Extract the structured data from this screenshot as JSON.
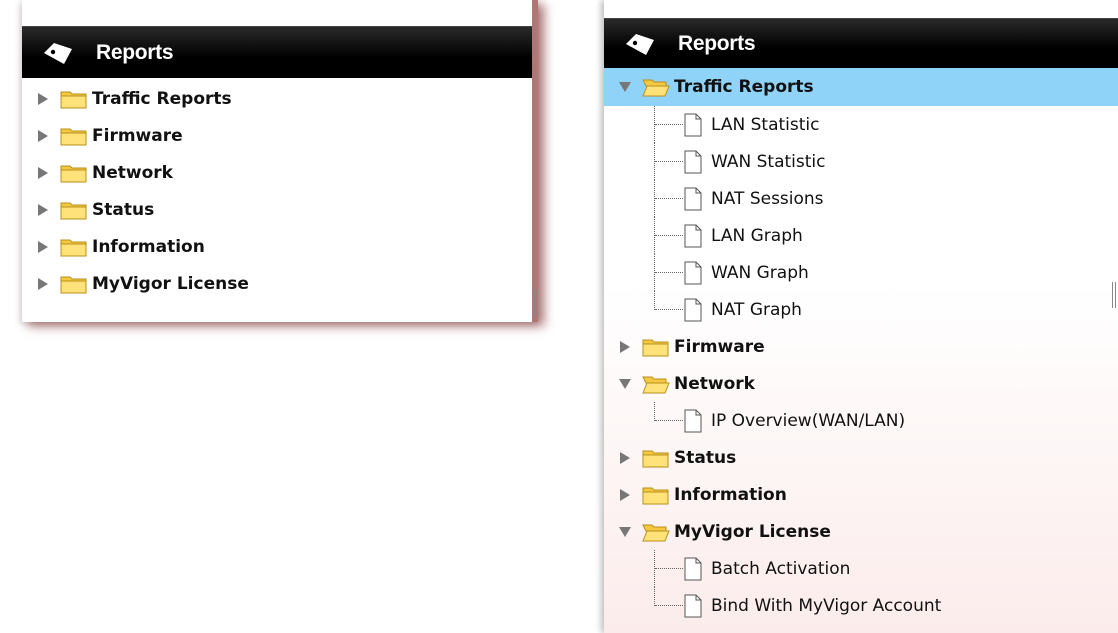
{
  "left_panel": {
    "title": "Reports",
    "items": [
      {
        "label": "Traffic Reports"
      },
      {
        "label": "Firmware"
      },
      {
        "label": "Network"
      },
      {
        "label": "Status"
      },
      {
        "label": "Information"
      },
      {
        "label": "MyVigor License"
      }
    ]
  },
  "right_panel": {
    "title": "Reports",
    "items": [
      {
        "label": "Traffic Reports",
        "expanded": true,
        "selected": true,
        "children": [
          "LAN Statistic",
          "WAN Statistic",
          "NAT Sessions",
          "LAN Graph",
          "WAN Graph",
          "NAT Graph"
        ]
      },
      {
        "label": "Firmware",
        "expanded": false
      },
      {
        "label": "Network",
        "expanded": true,
        "children": [
          "IP Overview(WAN/LAN)"
        ]
      },
      {
        "label": "Status",
        "expanded": false
      },
      {
        "label": "Information",
        "expanded": false
      },
      {
        "label": "MyVigor License",
        "expanded": true,
        "children": [
          "Batch Activation",
          "Bind With MyVigor Account"
        ]
      }
    ]
  },
  "icons": {
    "header": "reports-tag-icon",
    "collapsed": "triangle-right-icon",
    "expanded": "triangle-down-icon",
    "folder_closed": "folder-icon",
    "folder_open": "folder-open-icon",
    "document": "document-icon"
  },
  "colors": {
    "header_bg": "#000000",
    "selected_row": "#8fd3f8",
    "folder": "#f5c842",
    "panel_shadow": "#b07575"
  }
}
